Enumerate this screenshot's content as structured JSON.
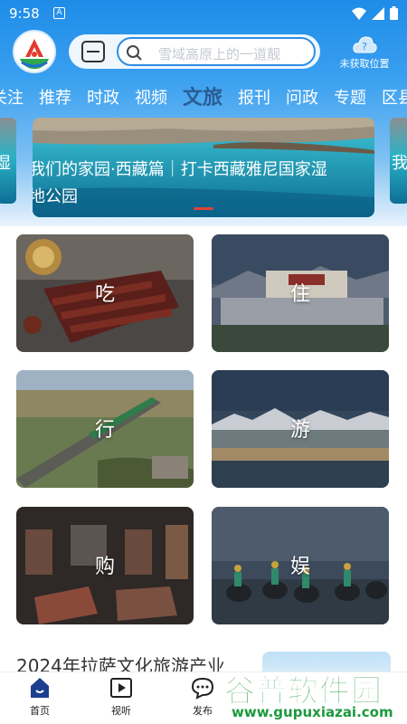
{
  "status_bar": {
    "time": "9:58",
    "notif_icon": "A"
  },
  "header": {
    "search_placeholder": "雪域高原上的一道靓",
    "location_label": "未获取位置",
    "location_icon": "question-cloud-icon"
  },
  "tabs": [
    {
      "label": "关注"
    },
    {
      "label": "推荐"
    },
    {
      "label": "时政"
    },
    {
      "label": "视频"
    },
    {
      "label": "文旅"
    },
    {
      "label": "报刊"
    },
    {
      "label": "问政"
    },
    {
      "label": "专题"
    },
    {
      "label": "区县"
    }
  ],
  "active_tab": "文旅",
  "banner": {
    "caption_line1": "我们的家园·西藏篇｜打卡西藏雅尼国家湿",
    "caption_line2": "地公园",
    "left_peek_caption": "湿",
    "right_peek_caption": "我们"
  },
  "categories": [
    {
      "label": "吃"
    },
    {
      "label": "住"
    },
    {
      "label": "行"
    },
    {
      "label": "游"
    },
    {
      "label": "购"
    },
    {
      "label": "娱"
    }
  ],
  "article": {
    "title": "2024年拉萨文化旅游产业"
  },
  "bottom_nav": [
    {
      "label": "首页"
    },
    {
      "label": "视听"
    },
    {
      "label": "发布"
    }
  ],
  "watermark": {
    "main": "谷普软件园",
    "sub": "www.gupuxiazai.com"
  },
  "colors": {
    "accent": "#1e8ce8",
    "active_tab": "#2a5c94",
    "indicator": "#e0433a",
    "watermark": "#1b9a3b"
  }
}
